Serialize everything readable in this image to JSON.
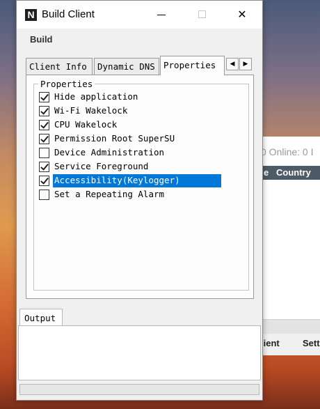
{
  "background_app": {
    "online_text": "0 Online: 0 I",
    "header_cols": [
      "e",
      "Country"
    ],
    "bottom_tabs": [
      "lient",
      "Sett"
    ]
  },
  "window": {
    "title": "Build Client",
    "icon_letter": "N",
    "close_glyph": "✕"
  },
  "menu": {
    "build_label": "Build"
  },
  "tabs": [
    {
      "label": "Client Info",
      "active": false
    },
    {
      "label": "Dynamic DNS",
      "active": false
    },
    {
      "label": "Properties",
      "active": true
    }
  ],
  "tab_scroll": {
    "left": "◀",
    "right": "▶"
  },
  "properties": {
    "group_title": "Properties",
    "options": [
      {
        "label": "Hide application",
        "checked": true,
        "selected": false
      },
      {
        "label": "Wi-Fi Wakelock",
        "checked": true,
        "selected": false
      },
      {
        "label": "CPU Wakelock",
        "checked": true,
        "selected": false
      },
      {
        "label": "Permission Root SuperSU",
        "checked": true,
        "selected": false
      },
      {
        "label": "Device Administration",
        "checked": false,
        "selected": false
      },
      {
        "label": "Service Foreground",
        "checked": true,
        "selected": false
      },
      {
        "label": "Accessibility(Keylogger)",
        "checked": true,
        "selected": true
      },
      {
        "label": "Set a Repeating Alarm",
        "checked": false,
        "selected": false
      }
    ]
  },
  "output": {
    "tab_label": "Output",
    "content": ""
  },
  "colors": {
    "selection": "#0078d7",
    "bg_header": "#4e5a66"
  }
}
